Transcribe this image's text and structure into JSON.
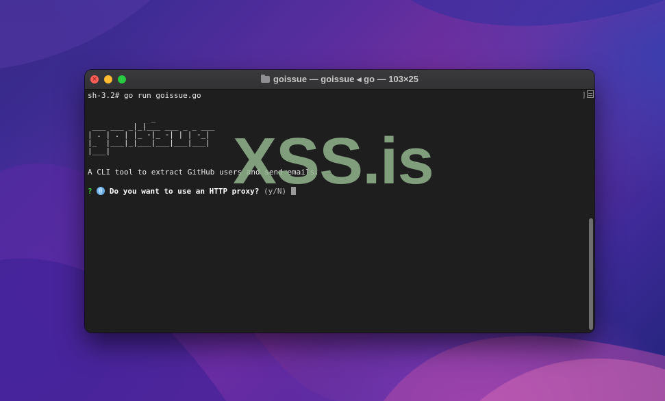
{
  "window": {
    "title": "goissue — goissue ◂ go — 103×25"
  },
  "terminal": {
    "prompt_line": "sh-3.2# go run goissue.go",
    "ascii_art": [
      "              _",
      " ___ ___ _|_|___ ___ _ _ ___",
      "| . | . | |_ -|_ -| | | -_|",
      "|_  |___|_|___|___|___|___|",
      "|___|"
    ],
    "description": "A CLI tool to extract GitHub users and send emails.",
    "question": {
      "mark": "?",
      "icon": "globe-icon",
      "text": "Do you want to use an HTTP proxy?",
      "hint": "(y/N)"
    },
    "scroll_bracket": "]"
  },
  "watermark": {
    "text": "XSS.is"
  },
  "colors": {
    "question_mark": "#3ec93e",
    "terminal_bg": "#1e1e1e",
    "watermark": "#96b991"
  }
}
